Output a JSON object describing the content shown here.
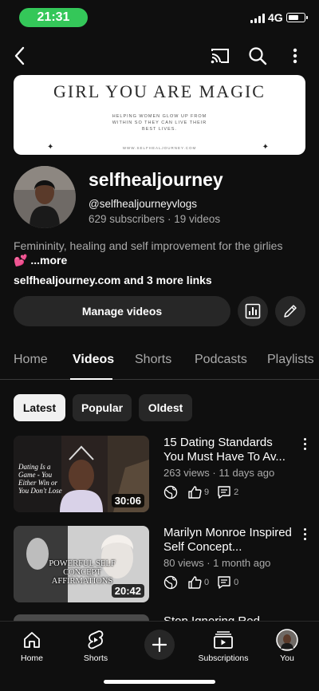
{
  "status_bar": {
    "time": "21:31",
    "network": "4G"
  },
  "banner": {
    "title": "GIRL YOU ARE MAGIC",
    "subtitle": "HELPING WOMEN GLOW UP FROM WITHIN SO THEY CAN LIVE THEIR BEST LIVES.",
    "url": "WWW.SELFHEALJOURNEY.COM"
  },
  "channel": {
    "name": "selfhealjourney",
    "handle": "@selfhealjourneyvlogs",
    "stats": "629 subscribers · 19 videos",
    "description": "Femininity, healing and self improvement for the girlies",
    "description_emoji": "💕",
    "more_label": " ...more",
    "links": "selfhealjourney.com and 3 more links",
    "manage_label": "Manage videos"
  },
  "tabs": [
    {
      "label": "Home",
      "active": false
    },
    {
      "label": "Videos",
      "active": true
    },
    {
      "label": "Shorts",
      "active": false
    },
    {
      "label": "Podcasts",
      "active": false
    },
    {
      "label": "Playlists",
      "active": false
    }
  ],
  "chips": [
    {
      "label": "Latest",
      "selected": true
    },
    {
      "label": "Popular",
      "selected": false
    },
    {
      "label": "Oldest",
      "selected": false
    }
  ],
  "videos": [
    {
      "title": "15 Dating Standards You Must Have To Av...",
      "meta": "263 views · 11 days ago",
      "duration": "30:06",
      "likes": "9",
      "comments": "2",
      "thumb_text": "Dating Is a Game - You Either Win or You Don't Lose"
    },
    {
      "title": "Marilyn Monroe Inspired Self Concept...",
      "meta": "80 views · 1 month ago",
      "duration": "20:42",
      "likes": "0",
      "comments": "0",
      "thumb_text": "POWERFUL SELF CONCEPT AFFIRMATIONS"
    },
    {
      "title": "Stop Ignoring Red"
    }
  ],
  "bottom_nav": [
    {
      "label": "Home",
      "icon": "home-icon"
    },
    {
      "label": "Shorts",
      "icon": "shorts-icon"
    },
    {
      "label": "",
      "icon": "create-icon"
    },
    {
      "label": "Subscriptions",
      "icon": "subscriptions-icon"
    },
    {
      "label": "You",
      "icon": "avatar-icon"
    }
  ],
  "colors": {
    "background": "#0f0f0f",
    "surface": "#272727",
    "status_pill": "#34c759",
    "secondary_text": "#aaaaaa"
  }
}
